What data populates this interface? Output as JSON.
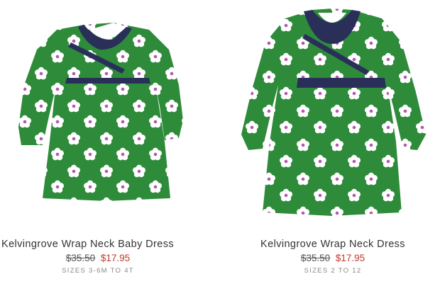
{
  "products": [
    {
      "name": "Kelvingrove Wrap Neck Baby Dress",
      "price_original": "$35.50",
      "price_sale": "$17.95",
      "sizes": "SIZES 3-6M TO 4T"
    },
    {
      "name": "Kelvingrove Wrap Neck Dress",
      "price_original": "$35.50",
      "price_sale": "$17.95",
      "sizes": "SIZES 2 TO 12"
    }
  ],
  "colors": {
    "dress_green": "#2e8b3a",
    "trim_navy": "#2a2f5a",
    "flower_white": "#ffffff",
    "flower_center": "#b05aa8",
    "sale_red": "#c0392b"
  }
}
